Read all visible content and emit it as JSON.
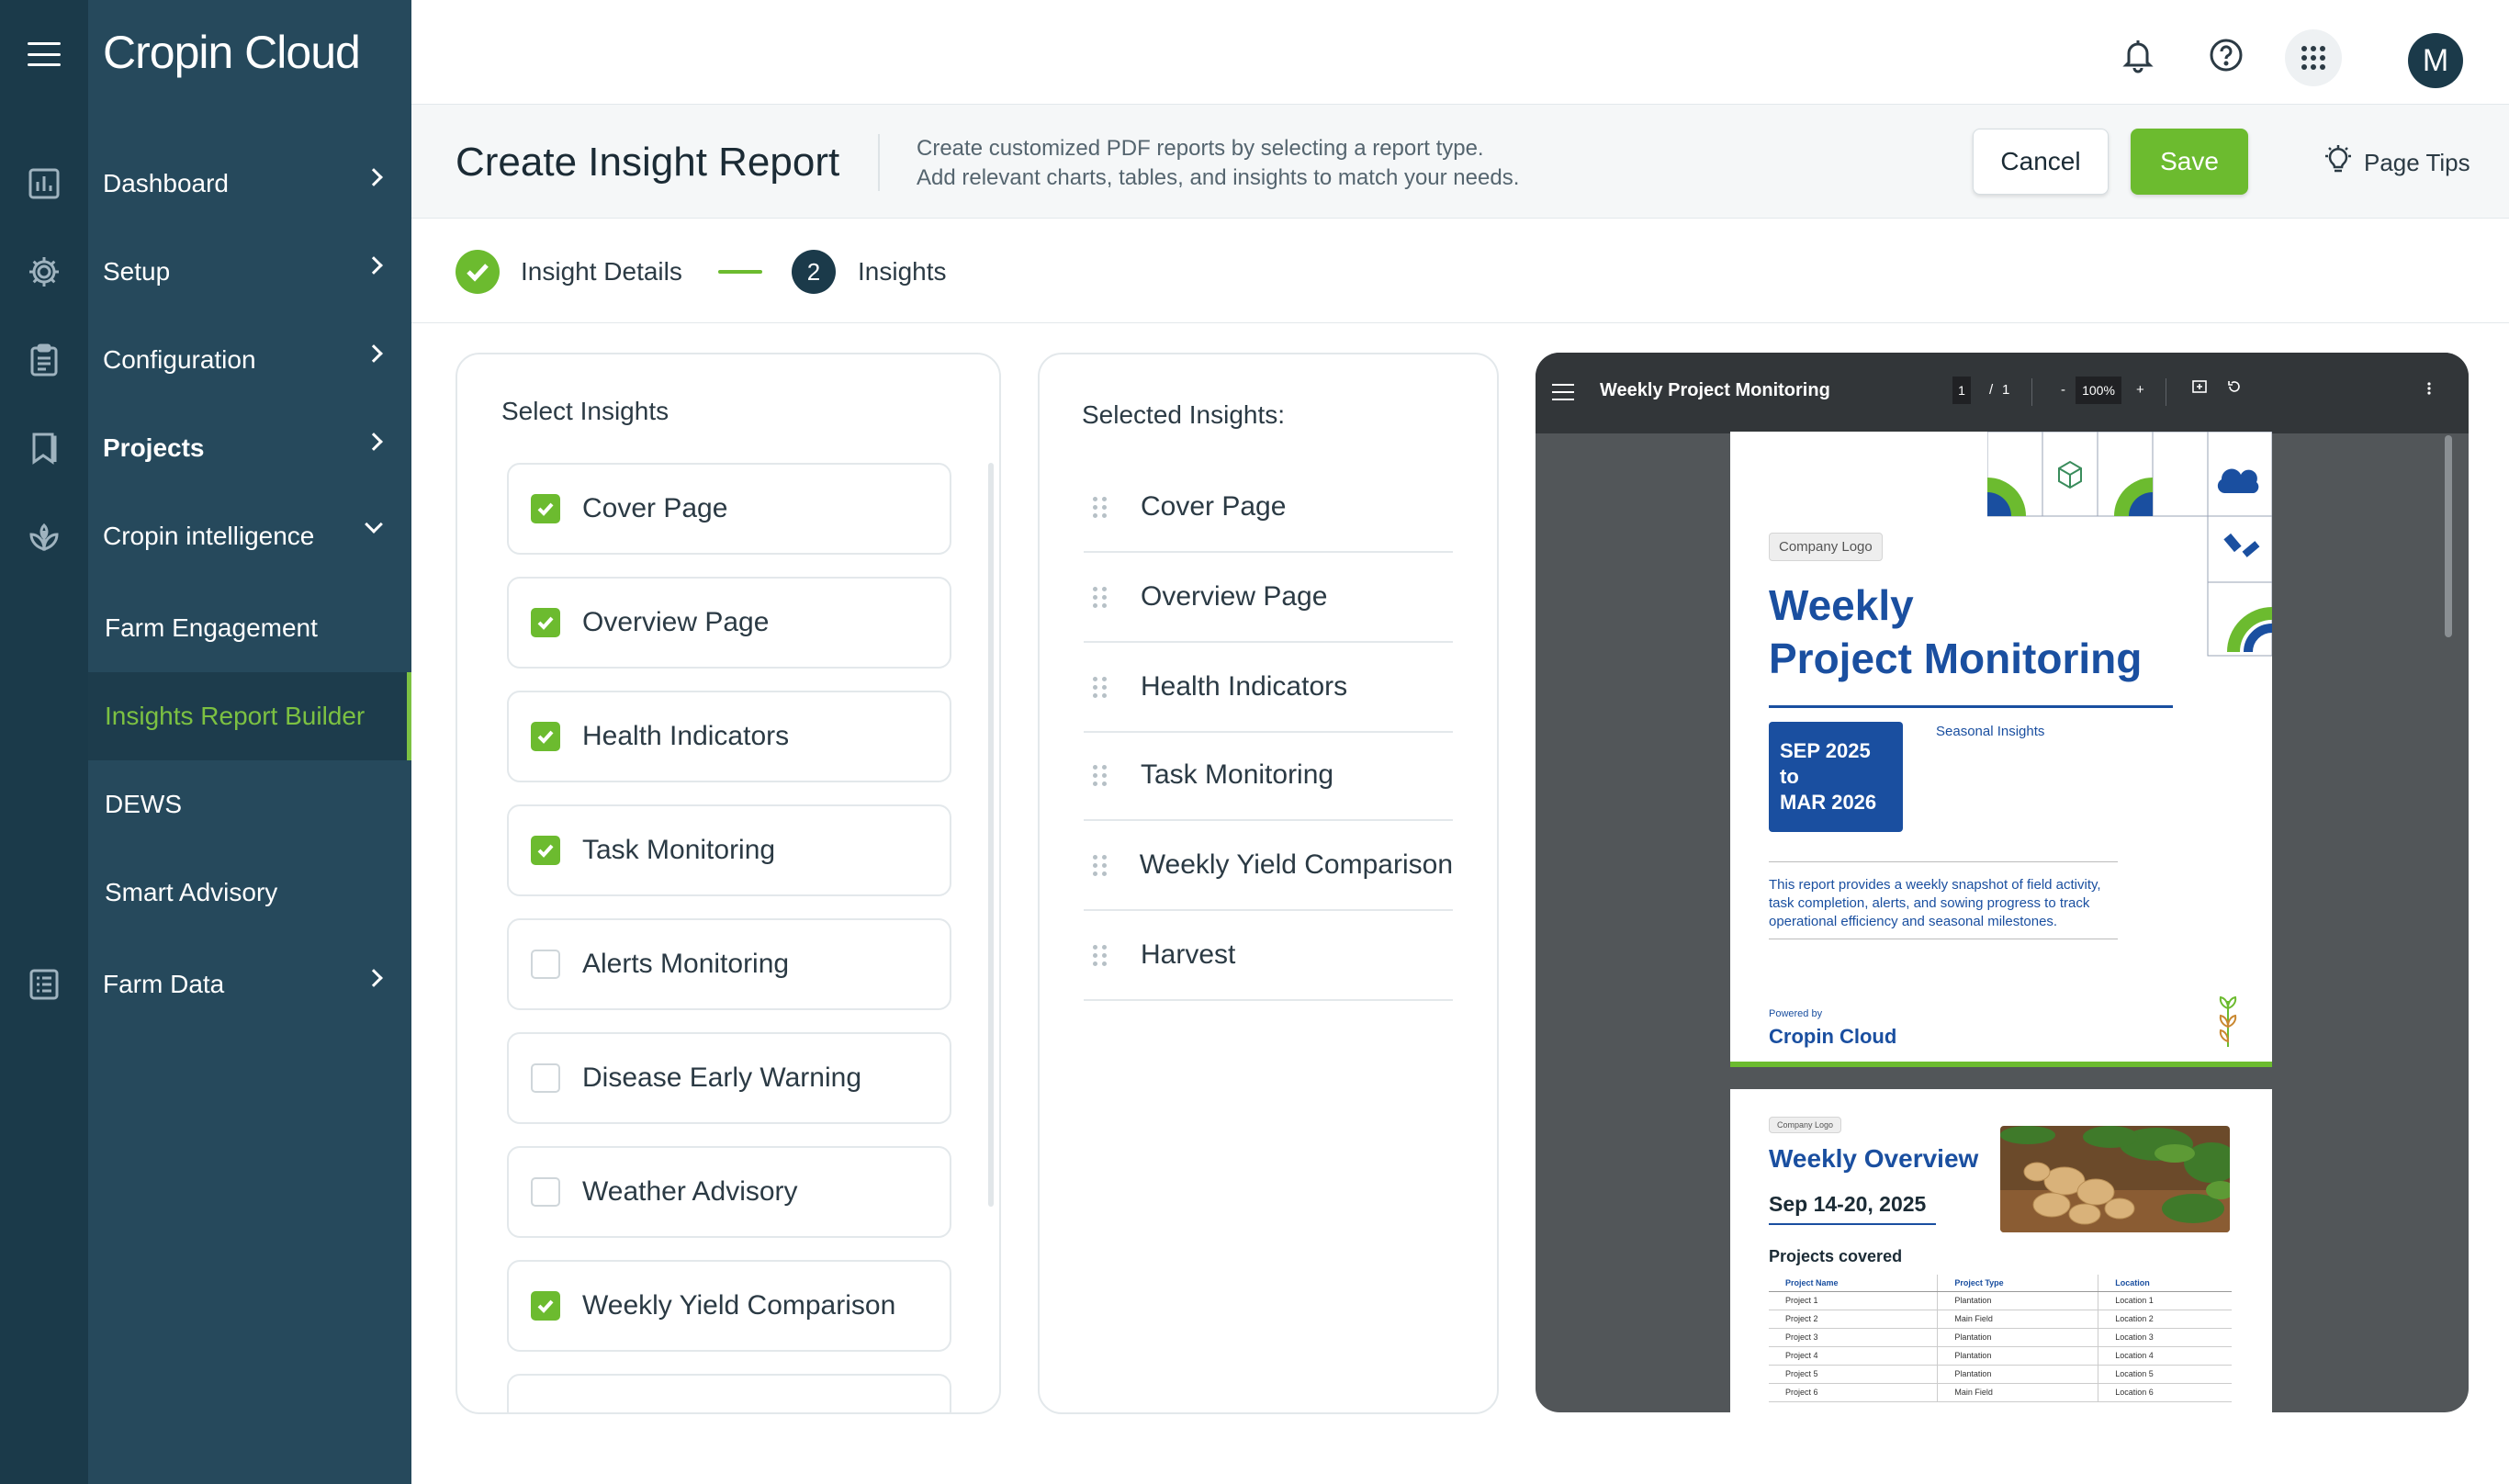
{
  "app": {
    "logo": "Cropin Cloud",
    "avatar_initial": "M"
  },
  "sidebar": {
    "items": [
      {
        "label": "Dashboard"
      },
      {
        "label": "Setup"
      },
      {
        "label": "Configuration"
      },
      {
        "label": "Projects"
      },
      {
        "label": "Cropin intelligence"
      },
      {
        "label": "Farm Engagement"
      },
      {
        "label": "Insights Report Builder"
      },
      {
        "label": "DEWS"
      },
      {
        "label": "Smart Advisory"
      },
      {
        "label": "Farm Data"
      }
    ]
  },
  "header": {
    "title": "Create Insight Report",
    "desc_line1": "Create customized PDF reports by selecting a report type.",
    "desc_line2": "Add relevant charts, tables, and insights to match your needs.",
    "cancel_label": "Cancel",
    "save_label": "Save",
    "tips_label": "Page Tips"
  },
  "stepper": {
    "step1_label": "Insight Details",
    "step2_number": "2",
    "step2_label": "Insights"
  },
  "select_panel": {
    "title": "Select Insights",
    "items": [
      {
        "label": "Cover Page",
        "checked": true
      },
      {
        "label": "Overview Page",
        "checked": true
      },
      {
        "label": "Health Indicators",
        "checked": true
      },
      {
        "label": "Task Monitoring",
        "checked": true
      },
      {
        "label": "Alerts Monitoring",
        "checked": false
      },
      {
        "label": "Disease Early Warning",
        "checked": false
      },
      {
        "label": "Weather Advisory",
        "checked": false
      },
      {
        "label": "Weekly Yield Comparison",
        "checked": true
      }
    ]
  },
  "selected_panel": {
    "title": "Selected Insights:",
    "items": [
      {
        "label": "Cover Page"
      },
      {
        "label": "Overview Page"
      },
      {
        "label": "Health Indicators"
      },
      {
        "label": "Task Monitoring"
      },
      {
        "label": "Weekly Yield Comparison"
      },
      {
        "label": "Harvest"
      }
    ]
  },
  "pdf_viewer": {
    "title": "Weekly Project Monitoring",
    "page_current": "1",
    "page_sep": "/",
    "page_total": "1",
    "zoom_minus": "-",
    "zoom": "100%",
    "zoom_plus": "+",
    "cover": {
      "logo_placeholder": "Company Logo",
      "title_line1": "Weekly",
      "title_line2": "Project Monitoring",
      "date_line1": "SEP 2025",
      "date_line2": "to",
      "date_line3": "MAR 2026",
      "tag": "Seasonal Insights",
      "desc_line1": "This report provides a weekly snapshot of field activity,",
      "desc_line2": "task completion, alerts, and sowing progress to track",
      "desc_line3": "operational efficiency and seasonal milestones.",
      "powered_by": "Powered by",
      "powered_logo": "Cropin Cloud"
    },
    "overview": {
      "logo_placeholder": "Company Logo",
      "title": "Weekly Overview",
      "date": "Sep 14-20, 2025",
      "projects_heading": "Projects covered",
      "table_headers": [
        "Project Name",
        "Project Type",
        "Location"
      ],
      "table_rows": [
        [
          "Project 1",
          "Plantation",
          "Location 1"
        ],
        [
          "Project 2",
          "Main Field",
          "Location 2"
        ],
        [
          "Project 3",
          "Plantation",
          "Location 3"
        ],
        [
          "Project 4",
          "Plantation",
          "Location 4"
        ],
        [
          "Project 5",
          "Plantation",
          "Location 5"
        ],
        [
          "Project 6",
          "Main Field",
          "Location 6"
        ]
      ]
    }
  },
  "colors": {
    "accent_green": "#6cbb2f",
    "sidebar_dark": "#1b3a4a",
    "sidebar": "#26495c",
    "report_blue": "#1a4fa0"
  }
}
